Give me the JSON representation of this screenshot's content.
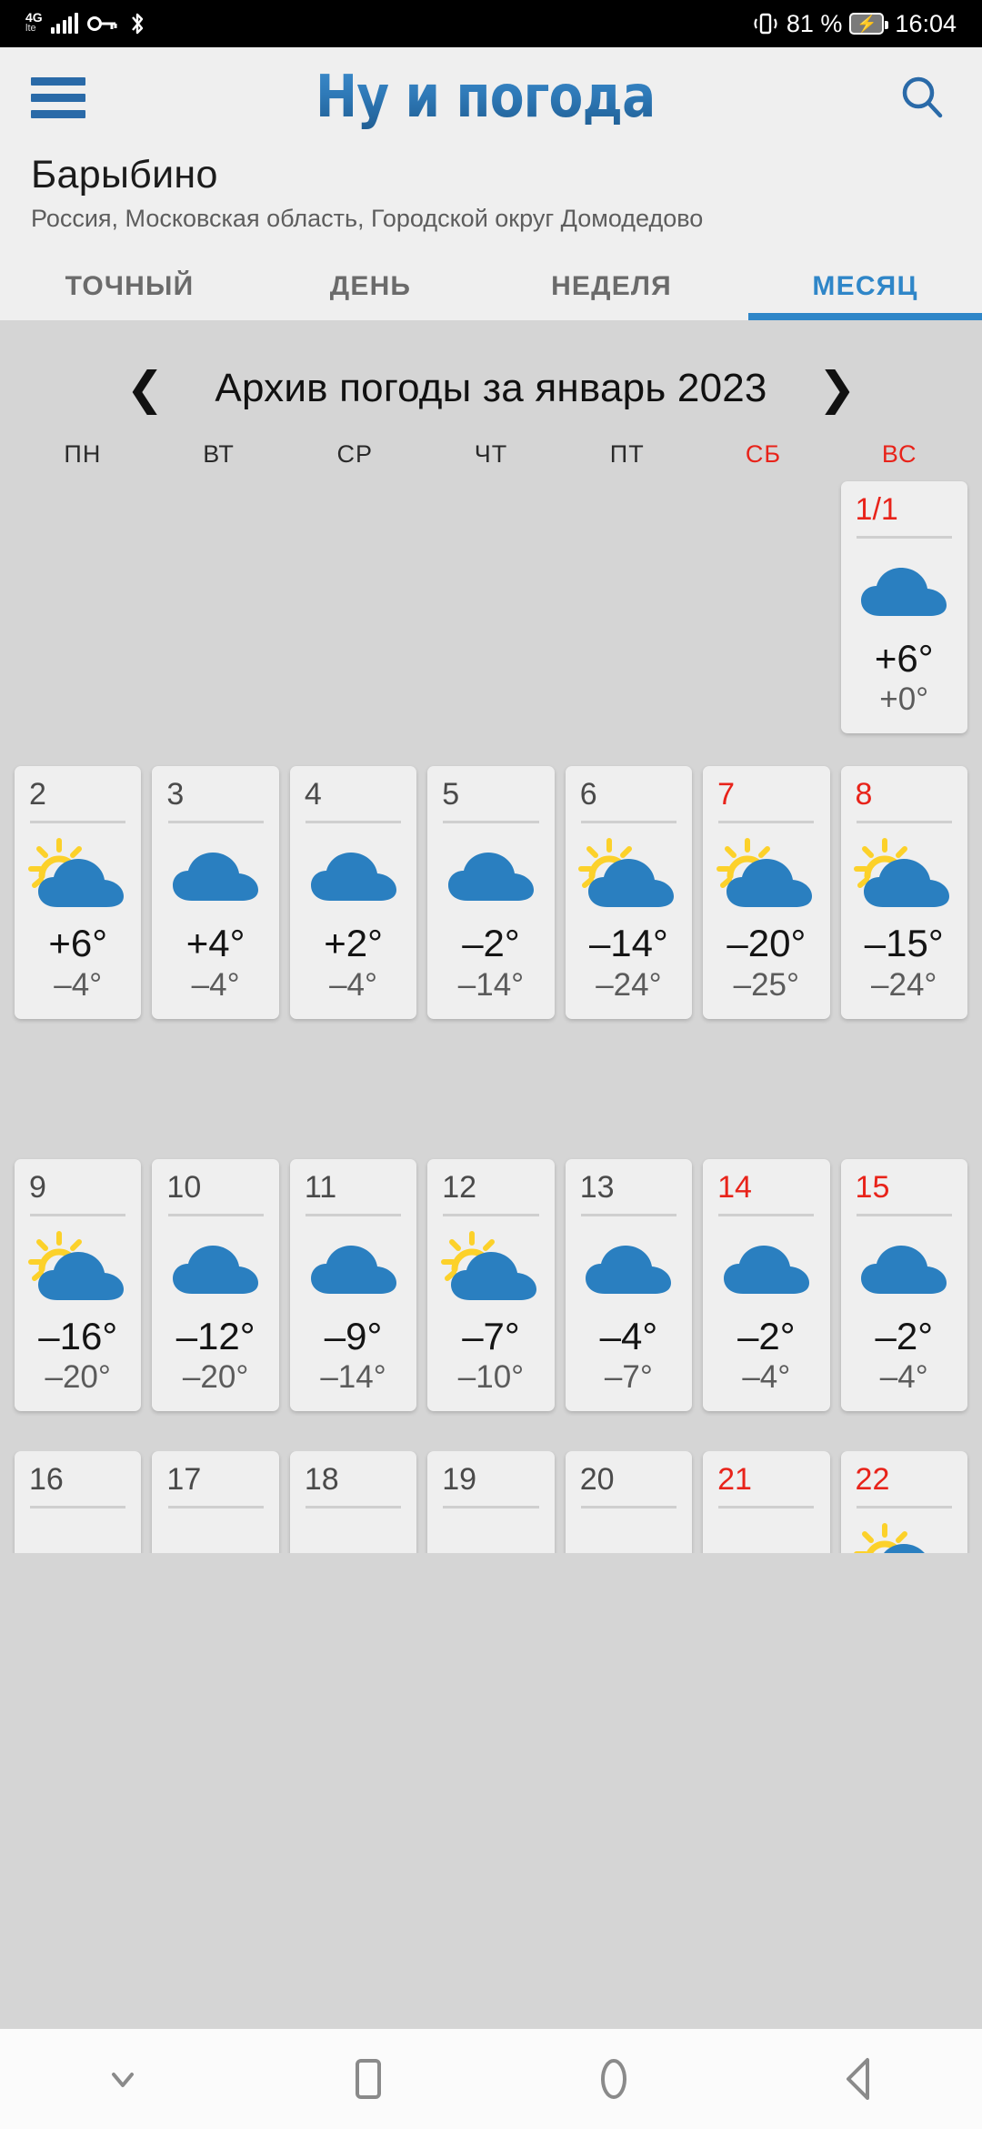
{
  "status_bar": {
    "network_type": "4G",
    "network_sub": "lte",
    "icons": [
      "signal-icon",
      "vpn-key-icon",
      "bluetooth-icon",
      "vibrate-icon",
      "battery-charging-icon"
    ],
    "battery_percent": "81 %",
    "time": "16:04"
  },
  "header": {
    "menu_icon": "hamburger-menu-icon",
    "logo_text": "Ну и погода",
    "search_icon": "search-icon",
    "city": "Барыбино",
    "region": "Россия, Московская область, Городской округ Домодедово",
    "tabs": [
      {
        "label": "ТОЧНЫЙ",
        "active": false
      },
      {
        "label": "ДЕНЬ",
        "active": false
      },
      {
        "label": "НЕДЕЛЯ",
        "active": false
      },
      {
        "label": "МЕСЯЦ",
        "active": true
      }
    ],
    "accent_color": "#2f86c8"
  },
  "calendar": {
    "title": "Архив погоды за январь 2023",
    "prev_icon": "chevron-left-icon",
    "next_icon": "chevron-right-icon",
    "weekdays": [
      {
        "label": "ПН",
        "weekend": false
      },
      {
        "label": "ВТ",
        "weekend": false
      },
      {
        "label": "СР",
        "weekend": false
      },
      {
        "label": "ЧТ",
        "weekend": false
      },
      {
        "label": "ПТ",
        "weekend": false
      },
      {
        "label": "СБ",
        "weekend": true
      },
      {
        "label": "ВС",
        "weekend": true
      }
    ],
    "weekend_color": "#e8231a",
    "cloud_color": "#2a7fc0",
    "sun_color": "#fcd12a",
    "weeks": [
      {
        "days": [
          {
            "empty": true
          },
          {
            "empty": true
          },
          {
            "empty": true
          },
          {
            "empty": true
          },
          {
            "empty": true
          },
          {
            "empty": true
          },
          {
            "empty": false,
            "date": "1/1",
            "weekend": true,
            "icon": "cloud-icon",
            "t_max": "+6°",
            "t_min": "+0°"
          }
        ]
      },
      {
        "days": [
          {
            "empty": false,
            "date": "2",
            "weekend": false,
            "icon": "sun-behind-cloud-icon",
            "t_max": "+6°",
            "t_min": "–4°"
          },
          {
            "empty": false,
            "date": "3",
            "weekend": false,
            "icon": "cloud-icon",
            "t_max": "+4°",
            "t_min": "–4°"
          },
          {
            "empty": false,
            "date": "4",
            "weekend": false,
            "icon": "cloud-icon",
            "t_max": "+2°",
            "t_min": "–4°"
          },
          {
            "empty": false,
            "date": "5",
            "weekend": false,
            "icon": "cloud-icon",
            "t_max": "–2°",
            "t_min": "–14°"
          },
          {
            "empty": false,
            "date": "6",
            "weekend": false,
            "icon": "sun-behind-cloud-icon",
            "t_max": "–14°",
            "t_min": "–24°"
          },
          {
            "empty": false,
            "date": "7",
            "weekend": true,
            "icon": "sun-behind-cloud-icon",
            "t_max": "–20°",
            "t_min": "–25°"
          },
          {
            "empty": false,
            "date": "8",
            "weekend": true,
            "icon": "sun-behind-cloud-icon",
            "t_max": "–15°",
            "t_min": "–24°"
          }
        ]
      },
      {
        "days": [
          {
            "empty": false,
            "date": "9",
            "weekend": false,
            "icon": "sun-behind-cloud-icon",
            "t_max": "–16°",
            "t_min": "–20°"
          },
          {
            "empty": false,
            "date": "10",
            "weekend": false,
            "icon": "cloud-icon",
            "t_max": "–12°",
            "t_min": "–20°"
          },
          {
            "empty": false,
            "date": "11",
            "weekend": false,
            "icon": "cloud-icon",
            "t_max": "–9°",
            "t_min": "–14°"
          },
          {
            "empty": false,
            "date": "12",
            "weekend": false,
            "icon": "sun-behind-cloud-icon",
            "t_max": "–7°",
            "t_min": "–10°"
          },
          {
            "empty": false,
            "date": "13",
            "weekend": false,
            "icon": "cloud-icon",
            "t_max": "–4°",
            "t_min": "–7°"
          },
          {
            "empty": false,
            "date": "14",
            "weekend": true,
            "icon": "cloud-icon",
            "t_max": "–2°",
            "t_min": "–4°"
          },
          {
            "empty": false,
            "date": "15",
            "weekend": true,
            "icon": "cloud-icon",
            "t_max": "–2°",
            "t_min": "–4°"
          }
        ]
      },
      {
        "partial": true,
        "days": [
          {
            "empty": false,
            "date": "16",
            "weekend": false,
            "icon": "",
            "t_max": "",
            "t_min": ""
          },
          {
            "empty": false,
            "date": "17",
            "weekend": false,
            "icon": "",
            "t_max": "",
            "t_min": ""
          },
          {
            "empty": false,
            "date": "18",
            "weekend": false,
            "icon": "",
            "t_max": "",
            "t_min": ""
          },
          {
            "empty": false,
            "date": "19",
            "weekend": false,
            "icon": "",
            "t_max": "",
            "t_min": ""
          },
          {
            "empty": false,
            "date": "20",
            "weekend": false,
            "icon": "",
            "t_max": "",
            "t_min": ""
          },
          {
            "empty": false,
            "date": "21",
            "weekend": true,
            "icon": "",
            "t_max": "",
            "t_min": ""
          },
          {
            "empty": false,
            "date": "22",
            "weekend": true,
            "icon": "sun-behind-cloud-icon",
            "t_max": "",
            "t_min": ""
          }
        ]
      }
    ]
  },
  "navbar": {
    "buttons": [
      {
        "icon": "chevron-down-icon",
        "name": "hide-navbar-button"
      },
      {
        "icon": "square-icon",
        "name": "recent-apps-button"
      },
      {
        "icon": "circle-icon",
        "name": "home-button"
      },
      {
        "icon": "triangle-left-icon",
        "name": "back-button"
      }
    ]
  }
}
